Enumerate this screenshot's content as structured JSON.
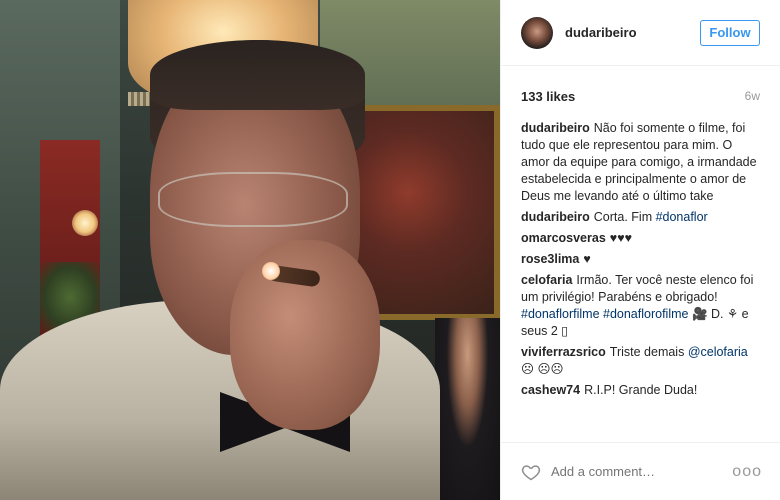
{
  "post": {
    "username": "dudaribeiro",
    "follow_label": "Follow",
    "likes": "133 likes",
    "age": "6w",
    "comments": [
      {
        "user": "dudaribeiro",
        "text": "Não foi somente o filme, foi tudo que ele representou para mim. O amor da equipe para comigo, a irmandade estabelecida e principalmente o amor de Deus me levando até o último take"
      },
      {
        "user": "dudaribeiro",
        "text": "Corta. Fim ",
        "tag": "#donaflor"
      },
      {
        "user": "omarcosveras",
        "text": "♥♥♥"
      },
      {
        "user": "rose3lima",
        "text": "♥"
      },
      {
        "user": "celofaria",
        "text": "Irmão. Ter você neste elenco foi um privilégio! Parabéns e obrigado! ",
        "tag": "#donaflorfilme #donaflorofilme",
        "text2": " 🎥 D. ⚘ e seus 2 ▯"
      },
      {
        "user": "viviferrazsrico",
        "text": "Triste demais ",
        "tag": "@celofaria",
        "text2": " ☹ ☹☹"
      },
      {
        "user": "cashew74",
        "text": "R.I.P! Grande Duda!"
      }
    ],
    "add_comment_placeholder": "Add a comment…",
    "more_label": "ooo"
  },
  "colors": {
    "link": "#003569",
    "follow": "#3897f0",
    "muted": "#999999"
  },
  "icons": {
    "heart": "heart-icon",
    "more": "more-options-icon",
    "avatar": "avatar"
  }
}
